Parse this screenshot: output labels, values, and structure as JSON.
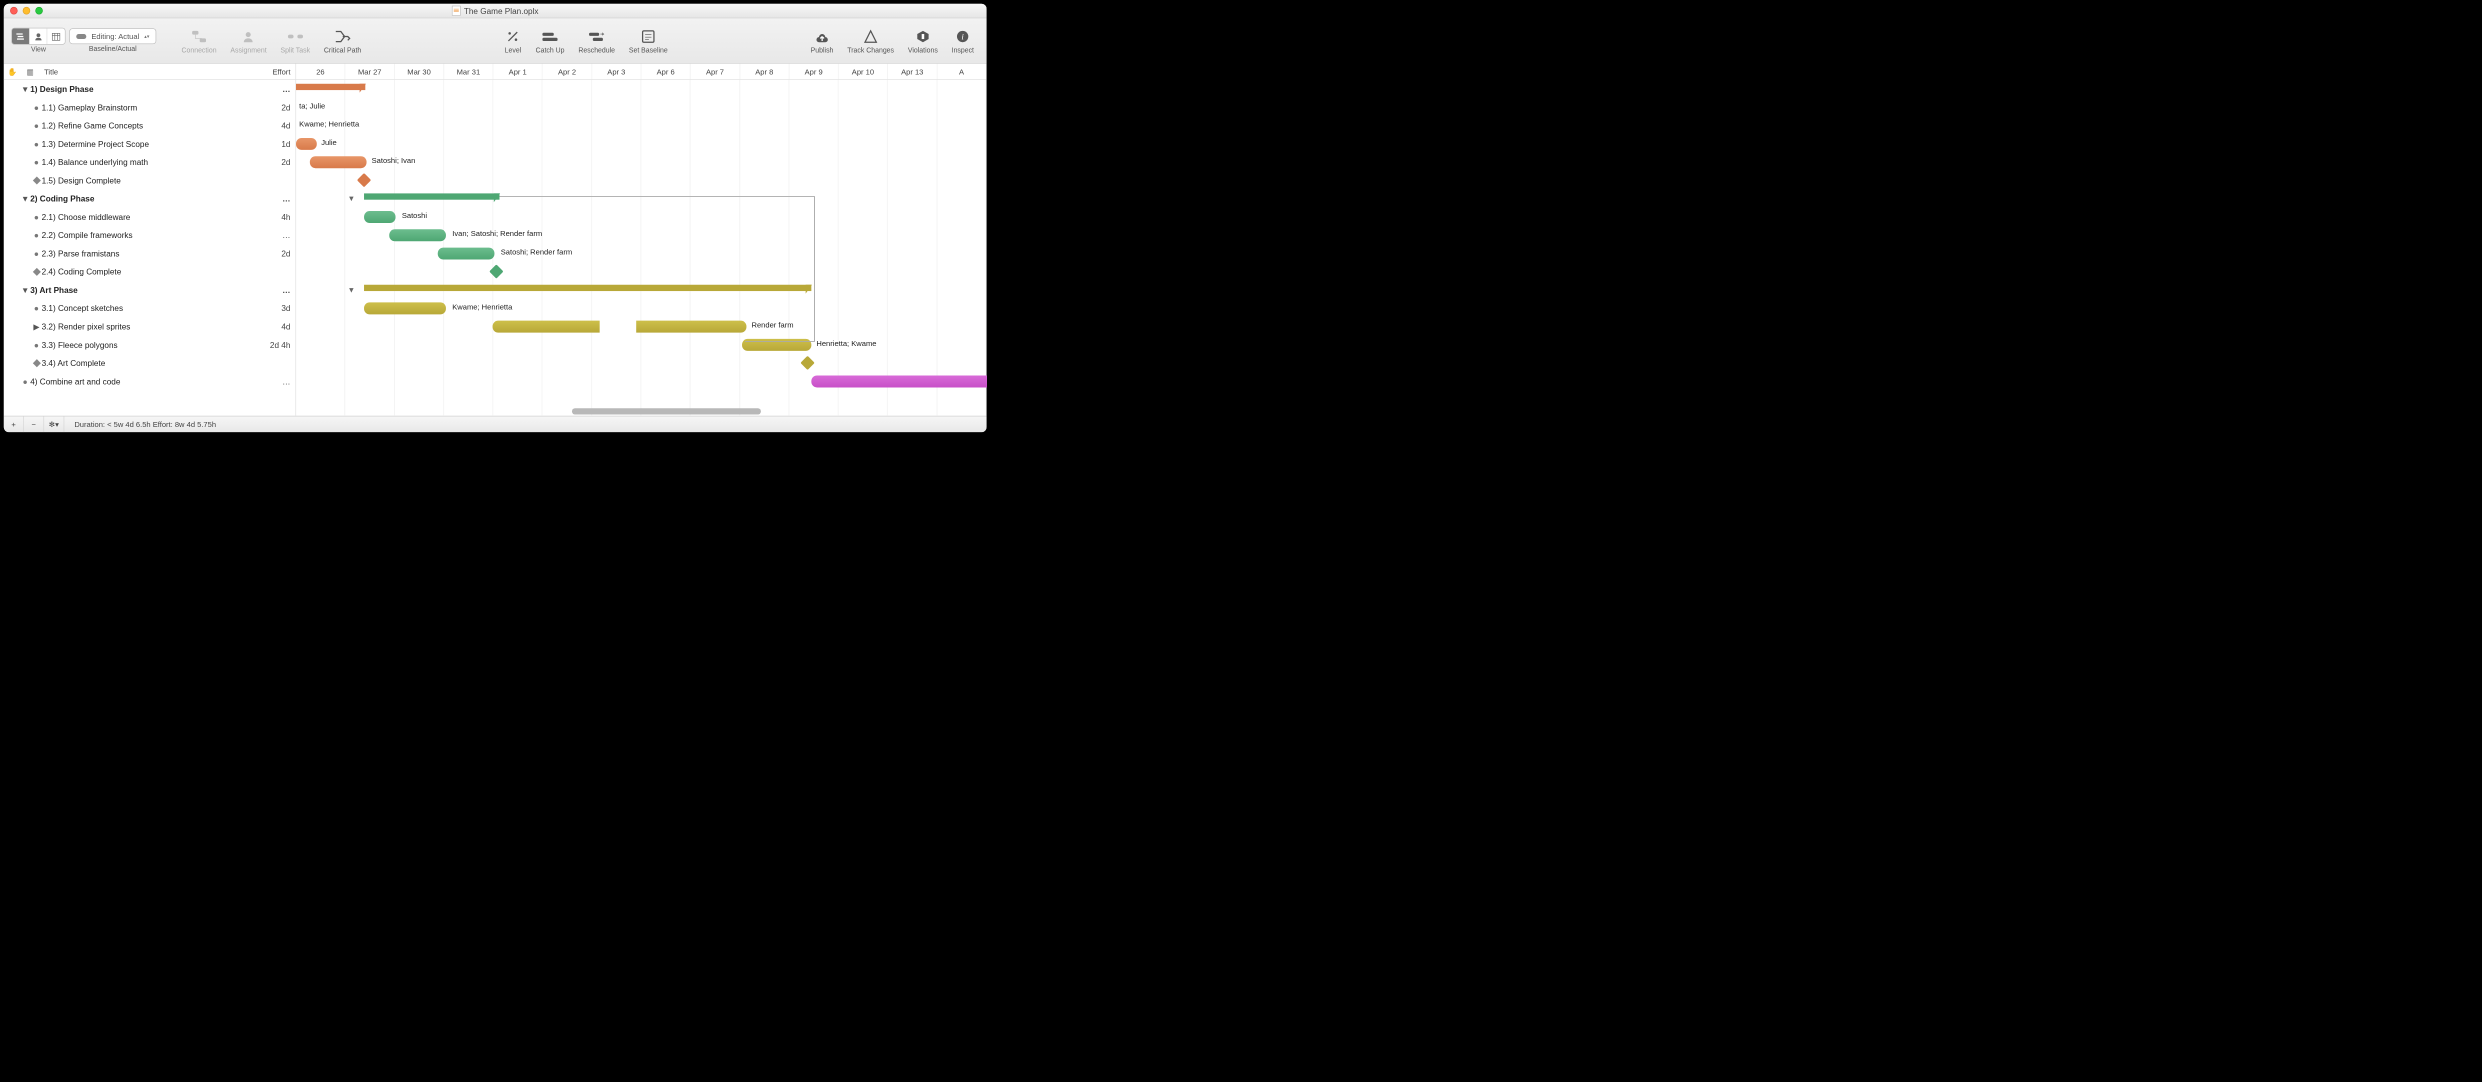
{
  "title": "The Game Plan.oplx",
  "toolbar": {
    "view_label": "View",
    "baseline_label": "Baseline/Actual",
    "editing_label": "Editing: Actual",
    "buttons": {
      "connection": "Connection",
      "assignment": "Assignment",
      "split": "Split Task",
      "critical": "Critical Path",
      "level": "Level",
      "catchup": "Catch Up",
      "reschedule": "Reschedule",
      "setbaseline": "Set Baseline",
      "publish": "Publish",
      "trackchanges": "Track Changes",
      "violations": "Violations",
      "inspect": "Inspect"
    }
  },
  "columns": {
    "title": "Title",
    "effort": "Effort"
  },
  "dates": [
    "26",
    "Mar 27",
    "Mar 30",
    "Mar 31",
    "Apr 1",
    "Apr 2",
    "Apr 3",
    "Apr 6",
    "Apr 7",
    "Apr 8",
    "Apr 9",
    "Apr 10",
    "Apr 13",
    "A"
  ],
  "rows": [
    {
      "kind": "summary",
      "indent": 1,
      "mark": "caret",
      "label": "1)  Design Phase",
      "effort": "…"
    },
    {
      "kind": "task",
      "indent": 2,
      "mark": "dot",
      "label": "1.1)  Gameplay Brainstorm",
      "effort": "2d"
    },
    {
      "kind": "task",
      "indent": 2,
      "mark": "dot",
      "label": "1.2)  Refine Game Concepts",
      "effort": "4d"
    },
    {
      "kind": "task",
      "indent": 2,
      "mark": "dot",
      "label": "1.3)  Determine Project Scope",
      "effort": "1d"
    },
    {
      "kind": "task",
      "indent": 2,
      "mark": "dot",
      "label": "1.4)  Balance underlying math",
      "effort": "2d"
    },
    {
      "kind": "milestone",
      "indent": 2,
      "mark": "diamond",
      "label": "1.5)  Design Complete",
      "effort": ""
    },
    {
      "kind": "summary",
      "indent": 1,
      "mark": "caret",
      "label": "2)  Coding Phase",
      "effort": "…"
    },
    {
      "kind": "task",
      "indent": 2,
      "mark": "dot",
      "label": "2.1)  Choose middleware",
      "effort": "4h"
    },
    {
      "kind": "task",
      "indent": 2,
      "mark": "dot",
      "label": "2.2)  Compile frameworks",
      "effort": "…"
    },
    {
      "kind": "task",
      "indent": 2,
      "mark": "dot",
      "label": "2.3)  Parse framistans",
      "effort": "2d"
    },
    {
      "kind": "milestone",
      "indent": 2,
      "mark": "diamond",
      "label": "2.4)  Coding Complete",
      "effort": ""
    },
    {
      "kind": "summary",
      "indent": 1,
      "mark": "caret",
      "label": "3)  Art Phase",
      "effort": "…"
    },
    {
      "kind": "task",
      "indent": 2,
      "mark": "dot",
      "label": "3.1)  Concept sketches",
      "effort": "3d"
    },
    {
      "kind": "task",
      "indent": 2,
      "mark": "caret-r",
      "label": "3.2)  Render pixel sprites",
      "effort": "4d"
    },
    {
      "kind": "task",
      "indent": 2,
      "mark": "dot",
      "label": "3.3)  Fleece polygons",
      "effort": "2d 4h"
    },
    {
      "kind": "milestone",
      "indent": 2,
      "mark": "diamond",
      "label": "3.4)  Art Complete",
      "effort": ""
    },
    {
      "kind": "task",
      "indent": 1,
      "mark": "dot",
      "label": "4)  Combine art and code",
      "effort": "…"
    }
  ],
  "gantt_labels": {
    "r1": "ta; Julie",
    "r2": "Kwame; Henrietta",
    "r3": "Julie",
    "r4": "Satoshi; Ivan",
    "r7": "Satoshi",
    "r8": "Ivan; Satoshi; Render farm",
    "r9": "Satoshi; Render farm",
    "r12": "Kwame; Henrietta",
    "r13": "Render farm",
    "r14": "Henrietta; Kwame"
  },
  "footer": {
    "status": "Duration: < 5w 4d 6.5h Effort: 8w 4d 5.75h"
  },
  "colors": {
    "orange": "#d87a4a",
    "green": "#4ea773",
    "yellow": "#b8a838",
    "magenta": "#c850c8"
  },
  "chart_data": {
    "type": "gantt",
    "time_axis": [
      "Mar 26",
      "Mar 27",
      "Mar 30",
      "Mar 31",
      "Apr 1",
      "Apr 2",
      "Apr 3",
      "Apr 6",
      "Apr 7",
      "Apr 8",
      "Apr 9",
      "Apr 10",
      "Apr 13"
    ],
    "tasks": [
      {
        "id": "1",
        "name": "Design Phase",
        "type": "summary",
        "start": "Mar 26",
        "end": "Mar 27",
        "color": "orange"
      },
      {
        "id": "1.1",
        "name": "Gameplay Brainstorm",
        "type": "task",
        "effort": "2d",
        "start": "Mar 26",
        "end": "Mar 26",
        "color": "orange",
        "resources": "ta; Julie"
      },
      {
        "id": "1.2",
        "name": "Refine Game Concepts",
        "type": "task",
        "effort": "4d",
        "start": "Mar 26",
        "end": "Mar 26",
        "color": "orange",
        "resources": "Kwame; Henrietta"
      },
      {
        "id": "1.3",
        "name": "Determine Project Scope",
        "type": "task",
        "effort": "1d",
        "start": "Mar 26",
        "end": "Mar 26",
        "color": "orange",
        "resources": "Julie"
      },
      {
        "id": "1.4",
        "name": "Balance underlying math",
        "type": "task",
        "effort": "2d",
        "start": "Mar 26",
        "end": "Mar 27",
        "color": "orange",
        "resources": "Satoshi; Ivan"
      },
      {
        "id": "1.5",
        "name": "Design Complete",
        "type": "milestone",
        "date": "Mar 27",
        "color": "orange"
      },
      {
        "id": "2",
        "name": "Coding Phase",
        "type": "summary",
        "start": "Mar 27",
        "end": "Apr 1",
        "color": "green"
      },
      {
        "id": "2.1",
        "name": "Choose middleware",
        "type": "task",
        "effort": "4h",
        "start": "Mar 27",
        "end": "Mar 30",
        "color": "green",
        "resources": "Satoshi"
      },
      {
        "id": "2.2",
        "name": "Compile frameworks",
        "type": "task",
        "start": "Mar 30",
        "end": "Mar 31",
        "color": "green",
        "resources": "Ivan; Satoshi; Render farm"
      },
      {
        "id": "2.3",
        "name": "Parse framistans",
        "type": "task",
        "effort": "2d",
        "start": "Mar 31",
        "end": "Apr 1",
        "color": "green",
        "resources": "Satoshi; Render farm"
      },
      {
        "id": "2.4",
        "name": "Coding Complete",
        "type": "milestone",
        "date": "Apr 1",
        "color": "green"
      },
      {
        "id": "3",
        "name": "Art Phase",
        "type": "summary",
        "start": "Mar 27",
        "end": "Apr 9",
        "color": "yellow"
      },
      {
        "id": "3.1",
        "name": "Concept sketches",
        "type": "task",
        "effort": "3d",
        "start": "Mar 27",
        "end": "Mar 31",
        "color": "yellow",
        "resources": "Kwame; Henrietta"
      },
      {
        "id": "3.2",
        "name": "Render pixel sprites",
        "type": "task",
        "effort": "4d",
        "segments": [
          {
            "start": "Apr 1",
            "end": "Apr 2"
          },
          {
            "start": "Apr 6",
            "end": "Apr 8"
          }
        ],
        "color": "yellow",
        "resources": "Render farm"
      },
      {
        "id": "3.3",
        "name": "Fleece polygons",
        "type": "task",
        "effort": "2d 4h",
        "start": "Apr 8",
        "end": "Apr 9",
        "color": "yellow",
        "resources": "Henrietta; Kwame"
      },
      {
        "id": "3.4",
        "name": "Art Complete",
        "type": "milestone",
        "date": "Apr 9",
        "color": "yellow"
      },
      {
        "id": "4",
        "name": "Combine art and code",
        "type": "task",
        "start": "Apr 9",
        "end": "Apr 13+",
        "color": "magenta"
      }
    ],
    "dependencies": [
      {
        "from": "2",
        "to": "3.3",
        "via": "Apr 9"
      }
    ]
  }
}
